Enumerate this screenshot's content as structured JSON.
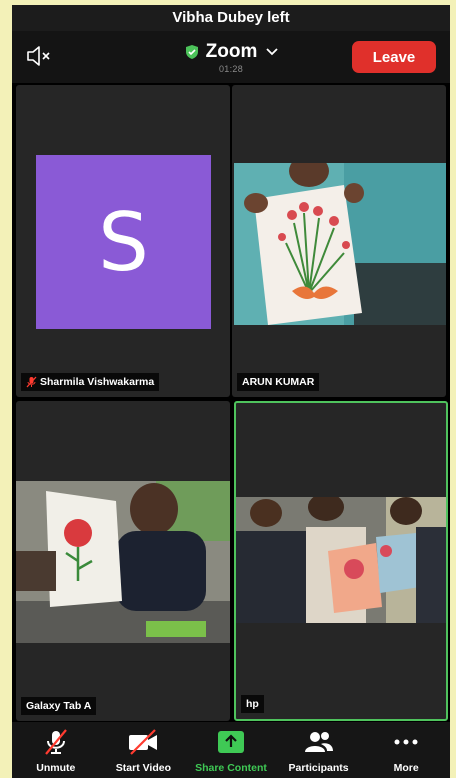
{
  "notice": "Vibha Dubey left",
  "header": {
    "title": "Zoom",
    "timer": "01:28",
    "leave_label": "Leave"
  },
  "participants": [
    {
      "name": "Sharmila Vishwakarma",
      "avatar_letter": "S",
      "muted": true
    },
    {
      "name": "ARUN KUMAR"
    },
    {
      "name": "Galaxy Tab A"
    },
    {
      "name": "hp",
      "active_speaker": true
    }
  ],
  "toolbar": {
    "unmute": "Unmute",
    "start_video": "Start Video",
    "share_content": "Share Content",
    "participants": "Participants",
    "more": "More"
  },
  "colors": {
    "leave": "#e0302b",
    "share": "#3fc955",
    "avatar": "#8a5ad6",
    "active_border": "#4fc35d"
  }
}
